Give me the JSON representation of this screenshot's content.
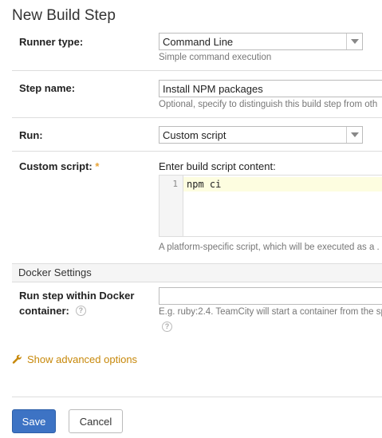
{
  "page": {
    "title": "New Build Step"
  },
  "runner_type": {
    "label": "Runner type:",
    "value": "Command Line",
    "hint": "Simple command execution"
  },
  "step_name": {
    "label": "Step name:",
    "value": "Install NPM packages",
    "hint": "Optional, specify to distinguish this build step from oth"
  },
  "run": {
    "label": "Run:",
    "value": "Custom script"
  },
  "custom_script": {
    "label": "Custom script:",
    "required_mark": "*",
    "caption": "Enter build script content:",
    "line_number": "1",
    "code": "npm ci",
    "hint": "A platform-specific script, which will be executed as a ."
  },
  "docker": {
    "section_title": "Docker Settings",
    "label_line1": "Run step within Docker",
    "label_line2": "container:",
    "value": "",
    "hint": "E.g. ruby:2.4. TeamCity will start a container from the sp",
    "help_glyph": "?"
  },
  "advanced": {
    "label": "Show advanced options",
    "icon": "wrench-icon",
    "color": "#c7880a"
  },
  "buttons": {
    "save": "Save",
    "cancel": "Cancel"
  },
  "colors": {
    "primary": "#3d73c4",
    "required": "#e8a335"
  }
}
